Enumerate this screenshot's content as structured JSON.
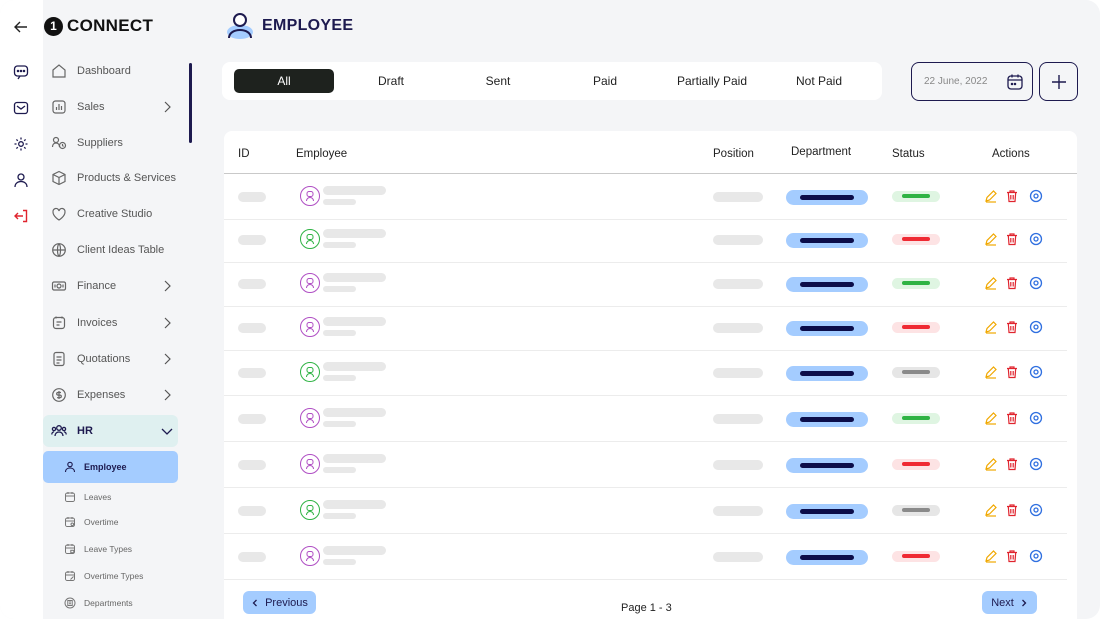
{
  "brand": {
    "logo_char": "1",
    "name": "CONNECT"
  },
  "page": {
    "title": "EMPLOYEE"
  },
  "sidebar": {
    "items": [
      {
        "id": "dashboard",
        "label": "Dashboard",
        "icon": "home-icon",
        "chevron": false
      },
      {
        "id": "sales",
        "label": "Sales",
        "icon": "chart-icon",
        "chevron": true
      },
      {
        "id": "suppliers",
        "label": "Suppliers",
        "icon": "suppliers-icon",
        "chevron": false
      },
      {
        "id": "products",
        "label": "Products & Services",
        "icon": "box-icon",
        "chevron": false
      },
      {
        "id": "creative",
        "label": "Creative Studio",
        "icon": "heart-icon",
        "chevron": false
      },
      {
        "id": "client-ideas",
        "label": "Client Ideas Table",
        "icon": "globe-icon",
        "chevron": false
      },
      {
        "id": "finance",
        "label": "Finance",
        "icon": "money-icon",
        "chevron": true
      },
      {
        "id": "invoices",
        "label": "Invoices",
        "icon": "invoice-icon",
        "chevron": true
      },
      {
        "id": "quotations",
        "label": "Quotations",
        "icon": "document-icon",
        "chevron": true
      },
      {
        "id": "expenses",
        "label": "Expenses",
        "icon": "dollar-icon",
        "chevron": true
      },
      {
        "id": "hr",
        "label": "HR",
        "icon": "users-icon",
        "chevron": true
      }
    ],
    "sub_items": [
      {
        "id": "employee",
        "label": "Employee",
        "icon": "user-icon",
        "active": true
      },
      {
        "id": "leaves",
        "label": "Leaves",
        "icon": "calendar-icon",
        "active": false
      },
      {
        "id": "overtime",
        "label": "Overtime",
        "icon": "calendar-clock-icon",
        "active": false
      },
      {
        "id": "leave-types",
        "label": "Leave Types",
        "icon": "calendar-lock-icon",
        "active": false
      },
      {
        "id": "overtime-types",
        "label": "Overtime Types",
        "icon": "calendar-edit-icon",
        "active": false
      },
      {
        "id": "departments",
        "label": "Departments",
        "icon": "building-icon",
        "active": false
      }
    ]
  },
  "filters": {
    "tabs": [
      {
        "label": "All",
        "active": true
      },
      {
        "label": "Draft",
        "active": false
      },
      {
        "label": "Sent",
        "active": false
      },
      {
        "label": "Paid",
        "active": false
      },
      {
        "label": "Partially Paid",
        "active": false
      },
      {
        "label": "Not Paid",
        "active": false
      }
    ],
    "date": "22 June, 2022"
  },
  "table": {
    "columns": {
      "id": "ID",
      "employee": "Employee",
      "position": "Position",
      "department": "Department",
      "status": "Status",
      "actions": "Actions"
    },
    "rows": [
      {
        "avatar_color": "#b04fc4",
        "status_color": "#2fb344"
      },
      {
        "avatar_color": "#2fb344",
        "status_color": "#ef2a33"
      },
      {
        "avatar_color": "#b04fc4",
        "status_color": "#2fb344"
      },
      {
        "avatar_color": "#b04fc4",
        "status_color": "#ef2a33"
      },
      {
        "avatar_color": "#2fb344",
        "status_color": "#8a8a8a"
      },
      {
        "avatar_color": "#b04fc4",
        "status_color": "#2fb344"
      },
      {
        "avatar_color": "#b04fc4",
        "status_color": "#ef2a33"
      },
      {
        "avatar_color": "#2fb344",
        "status_color": "#8a8a8a"
      },
      {
        "avatar_color": "#b04fc4",
        "status_color": "#ef2a33"
      }
    ]
  },
  "pagination": {
    "prev_label": "Previous",
    "next_label": "Next",
    "page_info": "Page 1 - 3"
  },
  "colors": {
    "accent": "#1d1a4f",
    "light_blue": "#a4ccff",
    "edit": "#f0a800",
    "delete": "#e0242e",
    "view": "#2f6fe0"
  }
}
